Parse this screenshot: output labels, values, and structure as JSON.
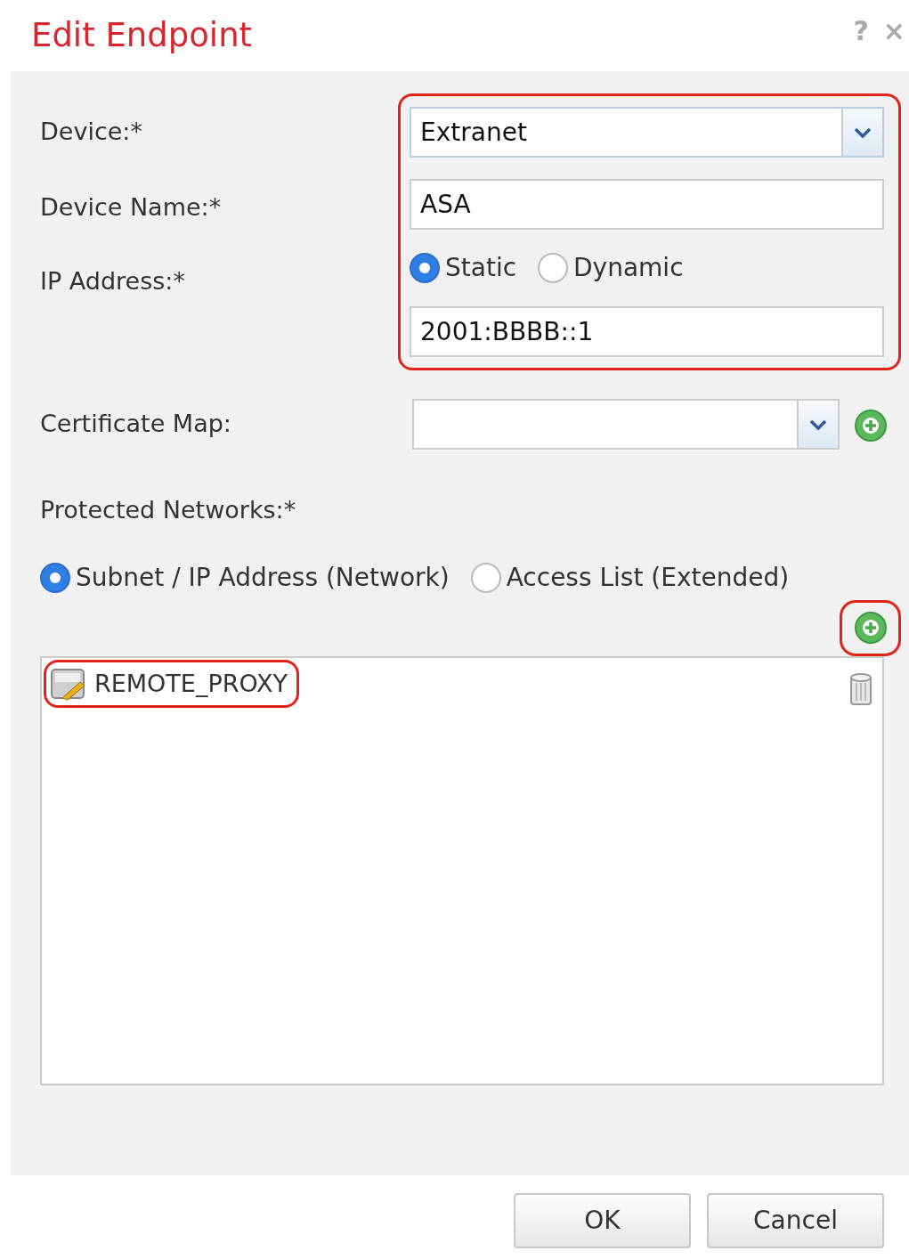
{
  "dialog": {
    "title": "Edit Endpoint",
    "help": "?",
    "close": "×"
  },
  "endpoint_group": {
    "highlighted": true,
    "device": {
      "label": "Device:*",
      "value": "Extranet"
    },
    "device_name": {
      "label": "Device Name:*",
      "value": "ASA"
    },
    "ip_address": {
      "label": "IP Address:*",
      "options": [
        {
          "label": "Static",
          "selected": true
        },
        {
          "label": "Dynamic",
          "selected": false
        }
      ],
      "value": "2001:BBBB::1"
    }
  },
  "certificate_map": {
    "label": "Certificate Map:"
  },
  "protected_networks": {
    "label": "Protected Networks:*",
    "options": [
      {
        "label": "Subnet / IP Address (Network)",
        "selected": true
      },
      {
        "label": "Access List (Extended)",
        "selected": false
      }
    ],
    "add_highlighted": true,
    "items": [
      {
        "name": "REMOTE_PROXY",
        "highlighted": true
      }
    ]
  },
  "buttons": [
    {
      "label": "OK"
    },
    {
      "label": "Cancel"
    }
  ]
}
